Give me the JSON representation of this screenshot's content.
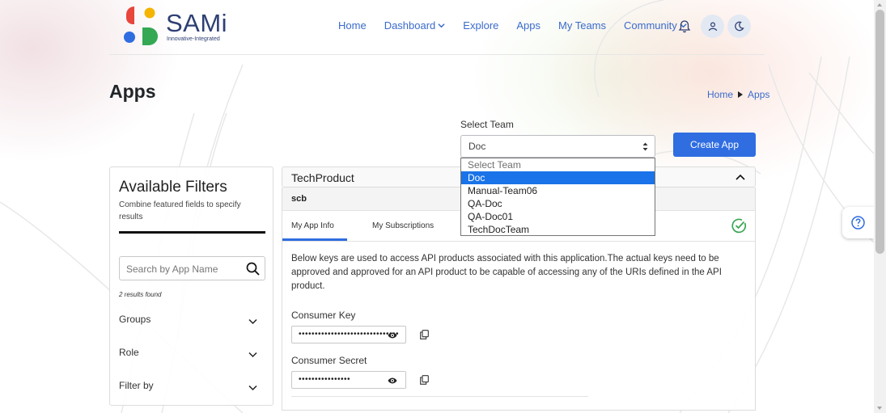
{
  "brand": {
    "name": "SAMi",
    "tagline": "Innovative-Integrated",
    "colors": {
      "red": "#e8453c",
      "yellow": "#f4b400",
      "blue": "#2f6de1",
      "green": "#34a853",
      "navy": "#2d3f73"
    }
  },
  "nav": {
    "items": [
      {
        "label": "Home"
      },
      {
        "label": "Dashboard",
        "has_dropdown": true
      },
      {
        "label": "Explore"
      },
      {
        "label": "Apps"
      },
      {
        "label": "My Teams"
      },
      {
        "label": "Community",
        "has_dropdown": true
      }
    ],
    "icons": [
      "bell-icon",
      "user-icon",
      "moon-icon"
    ]
  },
  "page": {
    "title": "Apps"
  },
  "breadcrumb": {
    "home": "Home",
    "current": "Apps"
  },
  "team_select": {
    "label": "Select Team",
    "value": "Doc",
    "options": [
      "Select Team",
      "Doc",
      "Manual-Team06",
      "QA-Doc",
      "QA-Doc01",
      "TechDocTeam"
    ],
    "highlighted": "Doc",
    "open": true
  },
  "create_app": {
    "label": "Create App"
  },
  "filters": {
    "title": "Available Filters",
    "subtitle": "Combine featured fields to specify results",
    "search_placeholder": "Search by App Name",
    "results_text": "2 results found",
    "facets": [
      {
        "label": "Groups"
      },
      {
        "label": "Role"
      },
      {
        "label": "Filter by"
      }
    ]
  },
  "app": {
    "name": "TechProduct",
    "product": "scb",
    "tabs": [
      "My App Info",
      "My Subscriptions"
    ],
    "active_tab": "My App Info",
    "status": "approved",
    "description": "Below keys are used to access API products associated with this application.The actual keys need to be approved and approved for an API product to be capable of accessing any of the URIs defined in the API product.",
    "consumer_key": {
      "label": "Consumer Key",
      "masked": "•••••••••••••••••••••••••••••••"
    },
    "consumer_secret": {
      "label": "Consumer Secret",
      "masked": "••••••••••••••••"
    }
  },
  "accent_color": "#2f6de1"
}
